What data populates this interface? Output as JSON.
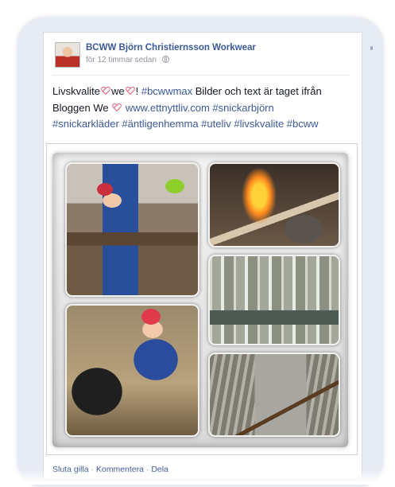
{
  "post": {
    "author": "BCWW Björn Christiernsson Workwear",
    "time": "för 12 timmar sedan",
    "text": {
      "line1_a": "Livskvalite",
      "line1_b": "we",
      "line1_c": "!",
      "line1_tag": "#bcwwmax",
      "line1_rest": " Bilder och text är taget ifrån",
      "line2_a": "Bloggen We",
      "line2_link": "www.ettnyttliv.com",
      "line2_tag": "#snickarbjörn",
      "line3_tags": "#snickarkläder #äntligenhemma #uteliv #livskvalite #bcww"
    }
  },
  "actions": {
    "like": "Sluta gilla",
    "comment": "Kommentera",
    "share": "Dela"
  },
  "icons": [
    "avatar",
    "globe-icon",
    "heart-icon"
  ],
  "colors": {
    "link": "#3b5998",
    "text": "#141823",
    "meta": "#90949c",
    "heart": "#e05a78",
    "frame": "#e7ebf4"
  }
}
